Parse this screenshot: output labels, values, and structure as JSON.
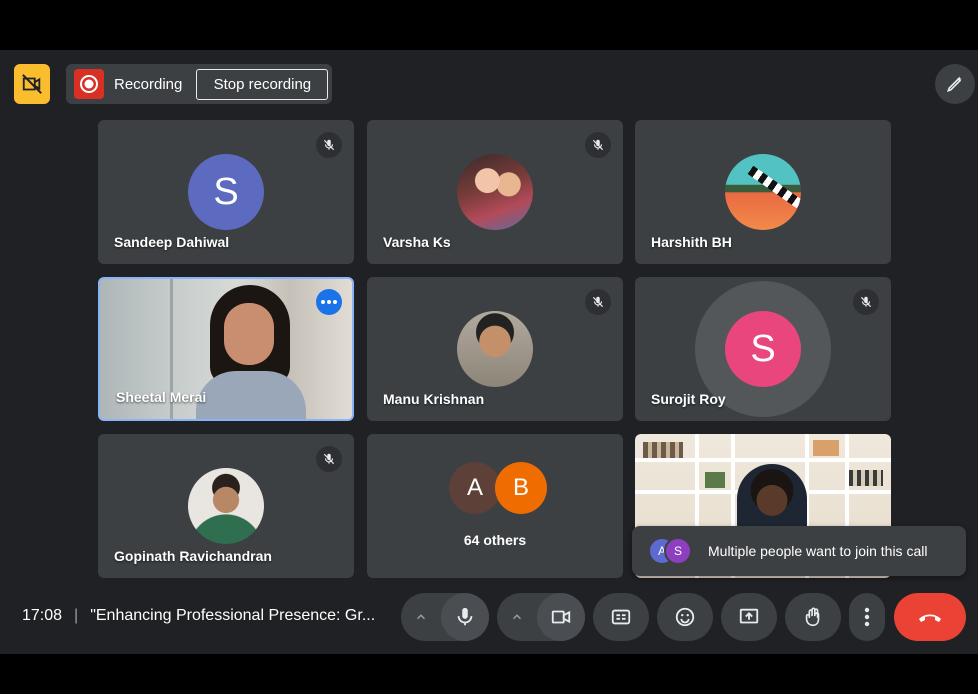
{
  "recording": {
    "label": "Recording",
    "stop_label": "Stop recording"
  },
  "tiles": [
    {
      "name": "Sandeep Dahiwal",
      "initial": "S",
      "avatar_color": "#5c6bc0",
      "muted": true
    },
    {
      "name": "Varsha Ks",
      "muted": true
    },
    {
      "name": "Harshith BH"
    },
    {
      "name": "Sheetal Merai",
      "active": true
    },
    {
      "name": "Manu Krishnan",
      "muted": true
    },
    {
      "name": "Surojit Roy",
      "initial": "S",
      "avatar_color": "#e8467c",
      "muted": true
    },
    {
      "name": "Gopinath Ravichandran",
      "muted": true
    }
  ],
  "others": {
    "label": "64 others",
    "avatars": [
      {
        "initial": "A",
        "color": "#5d4037"
      },
      {
        "initial": "B",
        "color": "#ef6c00"
      }
    ]
  },
  "toast": {
    "message": "Multiple people want to join this call",
    "avatars": [
      {
        "initial": "A",
        "color": "#5d6bd0"
      },
      {
        "initial": "S",
        "color": "#8e3fbf"
      }
    ]
  },
  "meeting": {
    "time": "17:08",
    "separator": "|",
    "title": "\"Enhancing Professional Presence: Gr..."
  },
  "colors": {
    "background": "#202124",
    "tile": "#3c4043",
    "accent": "#8ab4f8",
    "end_call": "#ea4335",
    "highlight_badge": "#f9bd2e",
    "recording": "#d93025"
  },
  "icons": [
    "camera-off-icon",
    "record-icon",
    "edit-icon",
    "mic-off-icon",
    "more-icon",
    "chevron-up-icon",
    "mic-icon",
    "camera-icon",
    "captions-icon",
    "emoji-icon",
    "present-icon",
    "raise-hand-icon",
    "more-vert-icon",
    "end-call-icon"
  ]
}
